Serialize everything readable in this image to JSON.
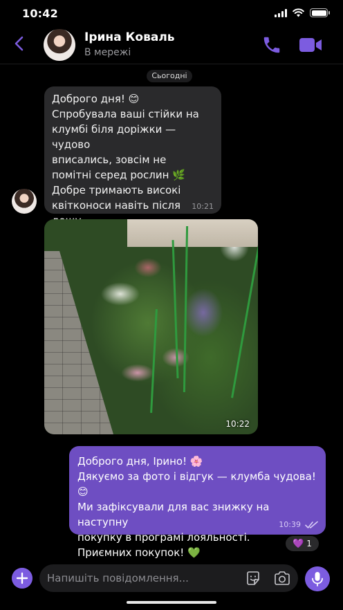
{
  "status_bar": {
    "time": "10:42"
  },
  "header": {
    "contact_name": "Ірина Коваль",
    "contact_status": "В мережі"
  },
  "conversation": {
    "date_label": "Сьогодні",
    "incoming_text": {
      "text": "Доброго дня! 😊\nСпробувала ваші стійки на\nклумбі біля доріжки — чудово\nвписались, зовсім не\nпомітні серед рослин 🌿\nДобре тримають високі\nквітконоси навіть після дощу,\nдуже дякую!",
      "time": "10:21"
    },
    "incoming_photo": {
      "time": "10:22"
    },
    "outgoing_text": {
      "text": "Доброго дня, Ірино! 🌸\nДякуємо за фото і відгук — клумба чудова! 😊\nМи зафіксували для вас знижку на наступну\nпокупку в програмі лояльності.\nПриємних покупок! 💚",
      "time": "10:39",
      "status": "read"
    },
    "reaction": {
      "emoji": "💜",
      "count": "1"
    }
  },
  "composer": {
    "placeholder": "Напишіть повідомлення..."
  },
  "colors": {
    "accent": "#7c5ce0",
    "outgoing_bubble": "#6e4ec2",
    "incoming_bubble": "#2a2a2c",
    "background": "#000000"
  },
  "icons": [
    "back-icon",
    "phone-icon",
    "video-icon",
    "plus-icon",
    "sticker-icon",
    "camera-icon",
    "microphone-icon",
    "double-check-icon"
  ]
}
